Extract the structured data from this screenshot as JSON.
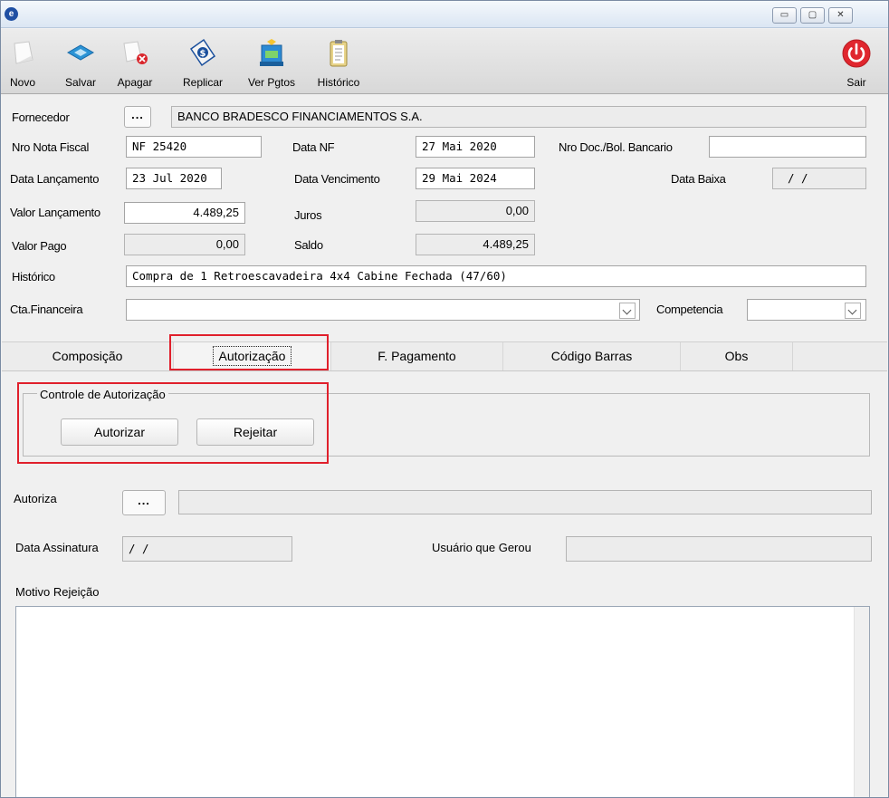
{
  "window": {
    "controls": {
      "minimize": "▭",
      "maximize": "▢",
      "close": "✕"
    }
  },
  "toolbar": {
    "buttons": [
      {
        "label": "Novo",
        "icon": "new-document-icon"
      },
      {
        "label": "Salvar",
        "icon": "save-icon"
      },
      {
        "label": "Apagar",
        "icon": "delete-icon"
      },
      {
        "label": "Replicar",
        "icon": "replicate-icon"
      },
      {
        "label": "Ver Pgtos",
        "icon": "view-payments-icon"
      },
      {
        "label": "Histórico",
        "icon": "history-clipboard-icon"
      },
      {
        "label": "Sair",
        "icon": "power-exit-icon"
      }
    ]
  },
  "form": {
    "fornecedor_label": "Fornecedor",
    "fornecedor_btn": "...",
    "fornecedor_value": "BANCO BRADESCO FINANCIAMENTOS S.A.",
    "nro_nota_label": "Nro Nota Fiscal",
    "nro_nota_value": "NF 25420",
    "data_nf_label": "Data NF",
    "data_nf_value": "27 Mai 2020",
    "nro_doc_label": "Nro Doc./Bol. Bancario",
    "nro_doc_value": "",
    "data_lanc_label": "Data Lançamento",
    "data_lanc_value": "23 Jul 2020",
    "data_venc_label": "Data Vencimento",
    "data_venc_value": "29 Mai 2024",
    "data_baixa_label": "Data Baixa",
    "data_baixa_value": "/ /",
    "valor_lanc_label": "Valor Lançamento",
    "valor_lanc_value": "4.489,25",
    "juros_label": "Juros",
    "juros_value": "0,00",
    "valor_pago_label": "Valor Pago",
    "valor_pago_value": "0,00",
    "saldo_label": "Saldo",
    "saldo_value": "4.489,25",
    "historico_label": "Histórico",
    "historico_value": "Compra de 1 Retroescavadeira 4x4 Cabine Fechada (47/60)",
    "cta_label": "Cta.Financeira",
    "cta_value": "",
    "competencia_label": "Competencia",
    "competencia_value": ""
  },
  "tabs": [
    {
      "label": "Composição"
    },
    {
      "label": "Autorização"
    },
    {
      "label": "F. Pagamento"
    },
    {
      "label": "Código Barras"
    },
    {
      "label": "Obs"
    }
  ],
  "autorizacao": {
    "group_title": "Controle de Autorização",
    "autorizar": "Autorizar",
    "rejeitar": "Rejeitar",
    "autoriza_label": "Autoriza",
    "autoriza_btn": "...",
    "autoriza_value": "",
    "data_assinatura_label": "Data Assinatura",
    "data_assinatura_value": "/ /",
    "usuario_label": "Usuário que Gerou",
    "usuario_value": "",
    "motivo_label": "Motivo Rejeição",
    "motivo_value": ""
  },
  "colors": {
    "highlight": "#e0202c",
    "toolbar_bg": "#e2e2e2",
    "panel_bg": "#f0f0f0"
  }
}
